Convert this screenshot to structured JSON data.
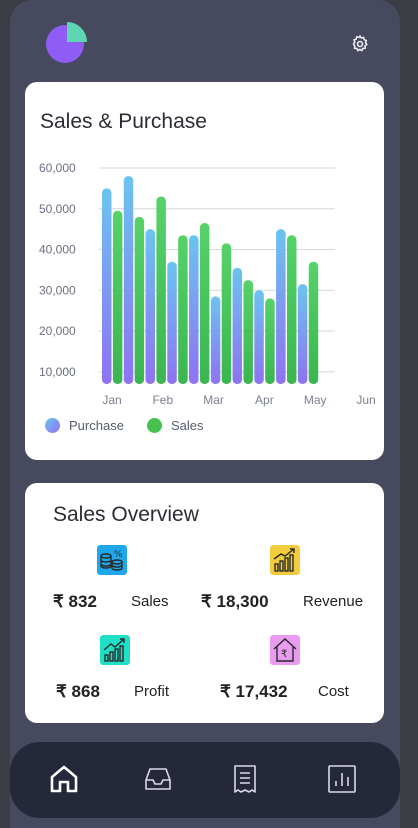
{
  "colors": {
    "background": "#474a5e",
    "purchase_gradient": [
      "#6bc4ef",
      "#8f72f2"
    ],
    "sales_gradient": [
      "#57d269",
      "#3ab651"
    ],
    "nav_background": "#25273a"
  },
  "header": {
    "logo_icon": "pie-chart-logo",
    "settings_icon": "gear-icon"
  },
  "sales_card": {
    "title": "Sales & Purchase",
    "legend": [
      {
        "label": "Purchase",
        "color": "#8fa6f3"
      },
      {
        "label": "Sales",
        "color": "#45c24f"
      }
    ]
  },
  "chart_data": {
    "type": "bar",
    "title": "Sales & Purchase",
    "categories": [
      "Jan",
      "Feb",
      "Mar",
      "Apr",
      "May",
      "Jun"
    ],
    "x_tick_labels": [
      "Jan",
      "Feb",
      "Mar",
      "Apr",
      "May",
      "Jun"
    ],
    "y_tick_labels": [
      "60,000",
      "50,000",
      "40,000",
      "30,000",
      "20,000",
      "10,000"
    ],
    "y_ticks": [
      60000,
      50000,
      40000,
      30000,
      20000,
      10000
    ],
    "ylim": [
      7000,
      60000
    ],
    "grid": true,
    "legend_position": "bottom-left",
    "bars": [
      {
        "series": "Purchase",
        "value": 55000
      },
      {
        "series": "Sales",
        "value": 49500
      },
      {
        "series": "Purchase",
        "value": 58000
      },
      {
        "series": "Sales",
        "value": 48000
      },
      {
        "series": "Purchase",
        "value": 45000
      },
      {
        "series": "Sales",
        "value": 53000
      },
      {
        "series": "Purchase",
        "value": 37000
      },
      {
        "series": "Sales",
        "value": 43500
      },
      {
        "series": "Purchase",
        "value": 43500
      },
      {
        "series": "Sales",
        "value": 46500
      },
      {
        "series": "Purchase",
        "value": 28500
      },
      {
        "series": "Sales",
        "value": 41500
      },
      {
        "series": "Purchase",
        "value": 35500
      },
      {
        "series": "Sales",
        "value": 32500
      },
      {
        "series": "Purchase",
        "value": 30000
      },
      {
        "series": "Sales",
        "value": 28000
      },
      {
        "series": "Purchase",
        "value": 45000
      },
      {
        "series": "Sales",
        "value": 43500
      },
      {
        "series": "Purchase",
        "value": 31500
      },
      {
        "series": "Sales",
        "value": 37000
      }
    ]
  },
  "overview": {
    "title": "Sales Overview",
    "items": [
      {
        "value": "₹ 832",
        "label": "Sales",
        "icon": "coins-percent-icon",
        "color": "#1ea7ea"
      },
      {
        "value": "₹ 18,300",
        "label": "Revenue",
        "icon": "growth-chart-icon",
        "color": "#f2cc3d"
      },
      {
        "value": "₹ 868",
        "label": "Profit",
        "icon": "profit-chart-icon",
        "color": "#1fe0c5"
      },
      {
        "value": "₹ 17,432",
        "label": "Cost",
        "icon": "rupee-house-icon",
        "color": "#e99bf0"
      }
    ]
  },
  "nav": [
    {
      "icon": "home-icon",
      "active": true
    },
    {
      "icon": "inbox-icon",
      "active": false
    },
    {
      "icon": "receipt-icon",
      "active": false
    },
    {
      "icon": "bar-chart-icon",
      "active": false
    }
  ]
}
